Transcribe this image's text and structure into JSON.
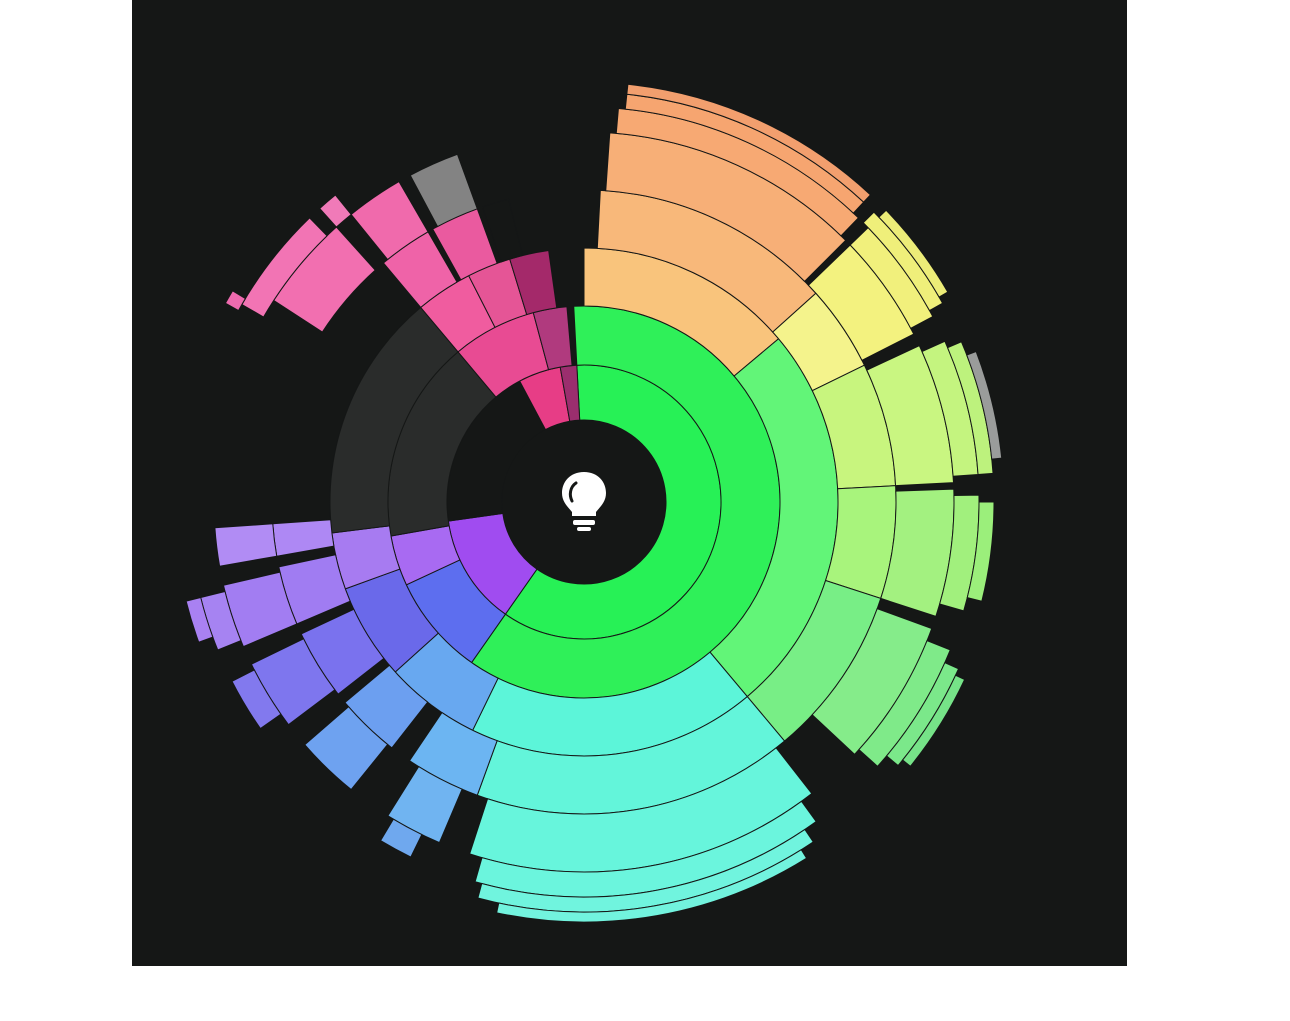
{
  "chart_data": {
    "type": "sunburst",
    "background": "#151716",
    "center_icon": "lightbulb-icon",
    "rings": [
      {
        "name": "ring-1",
        "segments": [
          {
            "label": "",
            "start": -3,
            "end": 215,
            "color": "#27F156"
          },
          {
            "label": "",
            "start": 215,
            "end": 262,
            "color": "#A04CF0"
          },
          {
            "label": "",
            "start": 262,
            "end": 332,
            "color": "#151716"
          },
          {
            "label": "",
            "start": 332,
            "end": 350,
            "color": "#E73D86"
          },
          {
            "label": "",
            "start": 350,
            "end": 357,
            "color": "#9B2E6E"
          }
        ]
      },
      {
        "name": "ring-2",
        "segments": [
          {
            "label": "",
            "start": -3,
            "end": 215,
            "color": "#2FF059"
          },
          {
            "label": "",
            "start": 215,
            "end": 245,
            "color": "#5D6EEF"
          },
          {
            "label": "",
            "start": 245,
            "end": 260,
            "color": "#A86AF2"
          },
          {
            "label": "",
            "start": 260,
            "end": 320,
            "color": "#2A2C2B"
          },
          {
            "label": "",
            "start": 320,
            "end": 345,
            "color": "#E84B93"
          },
          {
            "label": "",
            "start": 345,
            "end": 355,
            "color": "#B03A7E"
          }
        ]
      },
      {
        "name": "ring-3",
        "segments": [
          {
            "label": "",
            "start": 0,
            "end": 50,
            "color": "#F9C47C"
          },
          {
            "label": "",
            "start": 50,
            "end": 140,
            "color": "#62F578"
          },
          {
            "label": "",
            "start": 140,
            "end": 206,
            "color": "#5CF5D9"
          },
          {
            "label": "",
            "start": 206,
            "end": 228,
            "color": "#68A8F0"
          },
          {
            "label": "",
            "start": 228,
            "end": 250,
            "color": "#6A69EA"
          },
          {
            "label": "",
            "start": 250,
            "end": 263,
            "color": "#A77BF1"
          },
          {
            "label": "",
            "start": 263,
            "end": 320,
            "color": "#2A2C2B"
          },
          {
            "label": "",
            "start": 320,
            "end": 333,
            "color": "#F05C9F"
          },
          {
            "label": "",
            "start": 333,
            "end": 343,
            "color": "#E55596"
          },
          {
            "label": "",
            "start": 343,
            "end": 352,
            "color": "#A4296A"
          }
        ]
      },
      {
        "name": "ring-4",
        "segments": [
          {
            "label": "",
            "start": 3,
            "end": 48,
            "color": "#F8B87A"
          },
          {
            "label": "",
            "start": 48,
            "end": 64,
            "color": "#F4F38C"
          },
          {
            "label": "",
            "start": 64,
            "end": 87,
            "color": "#C8F57E"
          },
          {
            "label": "",
            "start": 87,
            "end": 108,
            "color": "#A8F47C"
          },
          {
            "label": "",
            "start": 108,
            "end": 140,
            "color": "#78EE86"
          },
          {
            "label": "",
            "start": 140,
            "end": 200,
            "color": "#63F5DA"
          },
          {
            "label": "",
            "start": 200,
            "end": 214,
            "color": "#6CB5F2"
          },
          {
            "label": "",
            "start": 218,
            "end": 230,
            "color": "#6C9FF0"
          },
          {
            "label": "",
            "start": 232,
            "end": 245,
            "color": "#7A72EE"
          },
          {
            "label": "",
            "start": 247,
            "end": 258,
            "color": "#A07CF2"
          },
          {
            "label": "",
            "start": 260,
            "end": 266,
            "color": "#AE88F4"
          },
          {
            "label": "",
            "start": 320,
            "end": 330,
            "color": "#EF63A8"
          },
          {
            "label": "",
            "start": 331,
            "end": 340,
            "color": "#EA5A9F"
          },
          {
            "label": "",
            "start": 341,
            "end": 346,
            "color": "#151716"
          }
        ]
      },
      {
        "name": "ring-5",
        "segments": [
          {
            "label": "",
            "start": 4,
            "end": 45,
            "color": "#F7AF77"
          },
          {
            "label": "",
            "start": 46,
            "end": 63,
            "color": "#F3F27F"
          },
          {
            "label": "",
            "start": 65,
            "end": 87,
            "color": "#C9F681"
          },
          {
            "label": "",
            "start": 88,
            "end": 108,
            "color": "#A3F180"
          },
          {
            "label": "",
            "start": 110,
            "end": 133,
            "color": "#85EC8A"
          },
          {
            "label": "",
            "start": 142,
            "end": 198,
            "color": "#67F5DC"
          },
          {
            "label": "",
            "start": 203,
            "end": 212,
            "color": "#70B4F1"
          },
          {
            "label": "",
            "start": 219,
            "end": 229,
            "color": "#6EA2F0"
          },
          {
            "label": "",
            "start": 233,
            "end": 244,
            "color": "#7E76EE"
          },
          {
            "label": "",
            "start": 247,
            "end": 257,
            "color": "#A27DF2"
          },
          {
            "label": "",
            "start": 260,
            "end": 266,
            "color": "#B18CF4"
          },
          {
            "label": "",
            "start": 303,
            "end": 318,
            "color": "#F26FB0"
          },
          {
            "label": "",
            "start": 321,
            "end": 330,
            "color": "#F06AAC"
          },
          {
            "label": "",
            "start": 332,
            "end": 340,
            "color": "#838383"
          }
        ]
      },
      {
        "name": "ring-6",
        "segments": [
          {
            "label": "",
            "start": 5,
            "end": 44,
            "color": "#F7A973"
          },
          {
            "label": "",
            "start": 46,
            "end": 62,
            "color": "#F1F07C"
          },
          {
            "label": "",
            "start": 66,
            "end": 86,
            "color": "#C4F47F"
          },
          {
            "label": "",
            "start": 89,
            "end": 106,
            "color": "#A1F07D"
          },
          {
            "label": "",
            "start": 112,
            "end": 132,
            "color": "#7FEA89"
          },
          {
            "label": "",
            "start": 144,
            "end": 196,
            "color": "#6BF5DD"
          },
          {
            "label": "",
            "start": 206,
            "end": 211,
            "color": "#6FA8EE"
          },
          {
            "label": "",
            "start": 235,
            "end": 243,
            "color": "#8279EE"
          },
          {
            "label": "",
            "start": 248,
            "end": 256,
            "color": "#A683F2"
          },
          {
            "label": "",
            "start": 300,
            "end": 316,
            "color": "#F274B4"
          },
          {
            "label": "",
            "start": 318,
            "end": 321,
            "color": "#F07AB8"
          }
        ]
      },
      {
        "name": "ring-7",
        "segments": [
          {
            "label": "",
            "start": 6,
            "end": 43,
            "color": "#F6A570"
          },
          {
            "label": "",
            "start": 45,
            "end": 61,
            "color": "#EFEF7A"
          },
          {
            "label": "",
            "start": 67,
            "end": 86,
            "color": "#BDF27D"
          },
          {
            "label": "",
            "start": 90,
            "end": 104,
            "color": "#9BEF7B"
          },
          {
            "label": "",
            "start": 114,
            "end": 130,
            "color": "#7BE88A"
          },
          {
            "label": "",
            "start": 146,
            "end": 195,
            "color": "#70F4DE"
          },
          {
            "label": "",
            "start": 250,
            "end": 256,
            "color": "#A981F2"
          },
          {
            "label": "",
            "start": 299,
            "end": 301,
            "color": "#EE6AAE"
          }
        ]
      },
      {
        "name": "ring-8",
        "segments": [
          {
            "label": "",
            "start": 6,
            "end": 43,
            "color": "#F29F6E"
          },
          {
            "label": "",
            "start": 46,
            "end": 60,
            "color": "#ECEC78"
          },
          {
            "label": "",
            "start": 69,
            "end": 84,
            "color": "#9A9C9B"
          },
          {
            "label": "",
            "start": 115,
            "end": 129,
            "color": "#76E388"
          },
          {
            "label": "",
            "start": 148,
            "end": 192,
            "color": "#72F3DE"
          }
        ]
      }
    ]
  }
}
